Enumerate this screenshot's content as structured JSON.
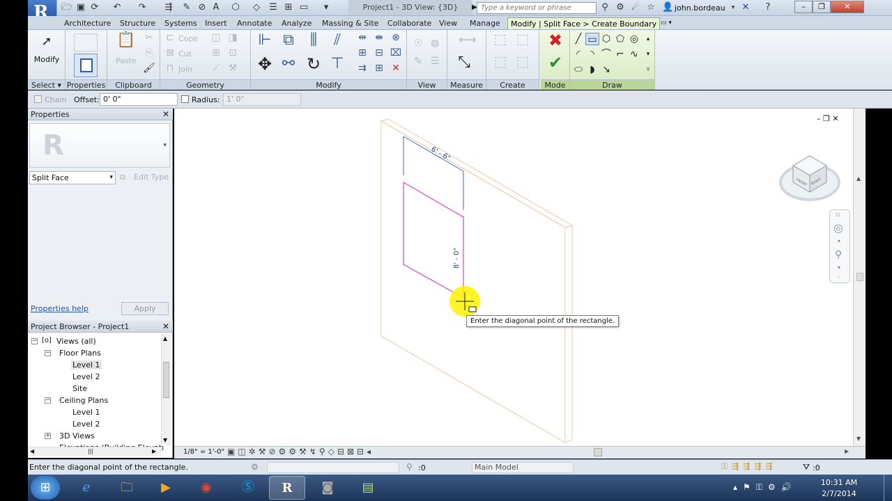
{
  "title_bar": {
    "window_title": "Project1 - 3D View: {3D}",
    "search_placeholder": "Type a keyword or phrase",
    "user": "john.bordeau"
  },
  "tabs": [
    "Architecture",
    "Structure",
    "Systems",
    "Insert",
    "Annotate",
    "Analyze",
    "Massing & Site",
    "Collaborate",
    "View",
    "Manage",
    "Modify | Split Face > Create Boundary"
  ],
  "ribbon": {
    "select": {
      "modify_label": "Modify",
      "label": "Select"
    },
    "properties": {
      "label": "Properties"
    },
    "clipboard": {
      "paste_label": "Paste",
      "label": "Clipboard"
    },
    "geometry": {
      "cope": "Cope",
      "cut": "Cut",
      "join": "Join",
      "label": "Geometry"
    },
    "modify": {
      "label": "Modify"
    },
    "view": {
      "label": "View"
    },
    "measure": {
      "label": "Measure"
    },
    "create": {
      "label": "Create"
    },
    "mode": {
      "label": "Mode"
    },
    "draw": {
      "label": "Draw"
    }
  },
  "options_bar": {
    "chain_label": "Chain",
    "offset_label": "Offset:",
    "offset_value": "0'  0\"",
    "radius_label": "Radius:",
    "radius_value": "1'  0\""
  },
  "properties_panel": {
    "title": "Properties",
    "type_selector": "Split Face",
    "edit_type": "Edit Type",
    "help_link": "Properties help",
    "apply": "Apply"
  },
  "project_browser": {
    "title": "Project Browser - Project1",
    "views_all": "Views (all)",
    "floor_plans": "Floor Plans",
    "fp_level1": "Level 1",
    "fp_level2": "Level 2",
    "fp_site": "Site",
    "ceiling_plans": "Ceiling Plans",
    "cp_level1": "Level 1",
    "cp_level2": "Level 2",
    "views_3d": "3D Views",
    "elevations": "Elevations (Building Elevation"
  },
  "canvas": {
    "dim_top": "6' - 6\"",
    "dim_side": "8' - 0\"",
    "tooltip": "Enter the diagonal point of the rectangle.",
    "viewcube_left": "FRONT",
    "viewcube_right": "RIGHT"
  },
  "view_bar": {
    "scale": "1/8\" = 1'-0\""
  },
  "status_bar": {
    "prompt": "Enter the diagonal point of the rectangle.",
    "selection_count": ":0",
    "model": "Main Model",
    "filter_count": ":0"
  },
  "taskbar": {
    "time": "10:31 AM",
    "date": "2/7/2014"
  },
  "colors": {
    "sketch": "#e040c8",
    "dimension": "#1b3ea8",
    "wall_edge": "#e8c9a8",
    "context_tab": "#e9f3d7",
    "highlight": "#fff200"
  }
}
